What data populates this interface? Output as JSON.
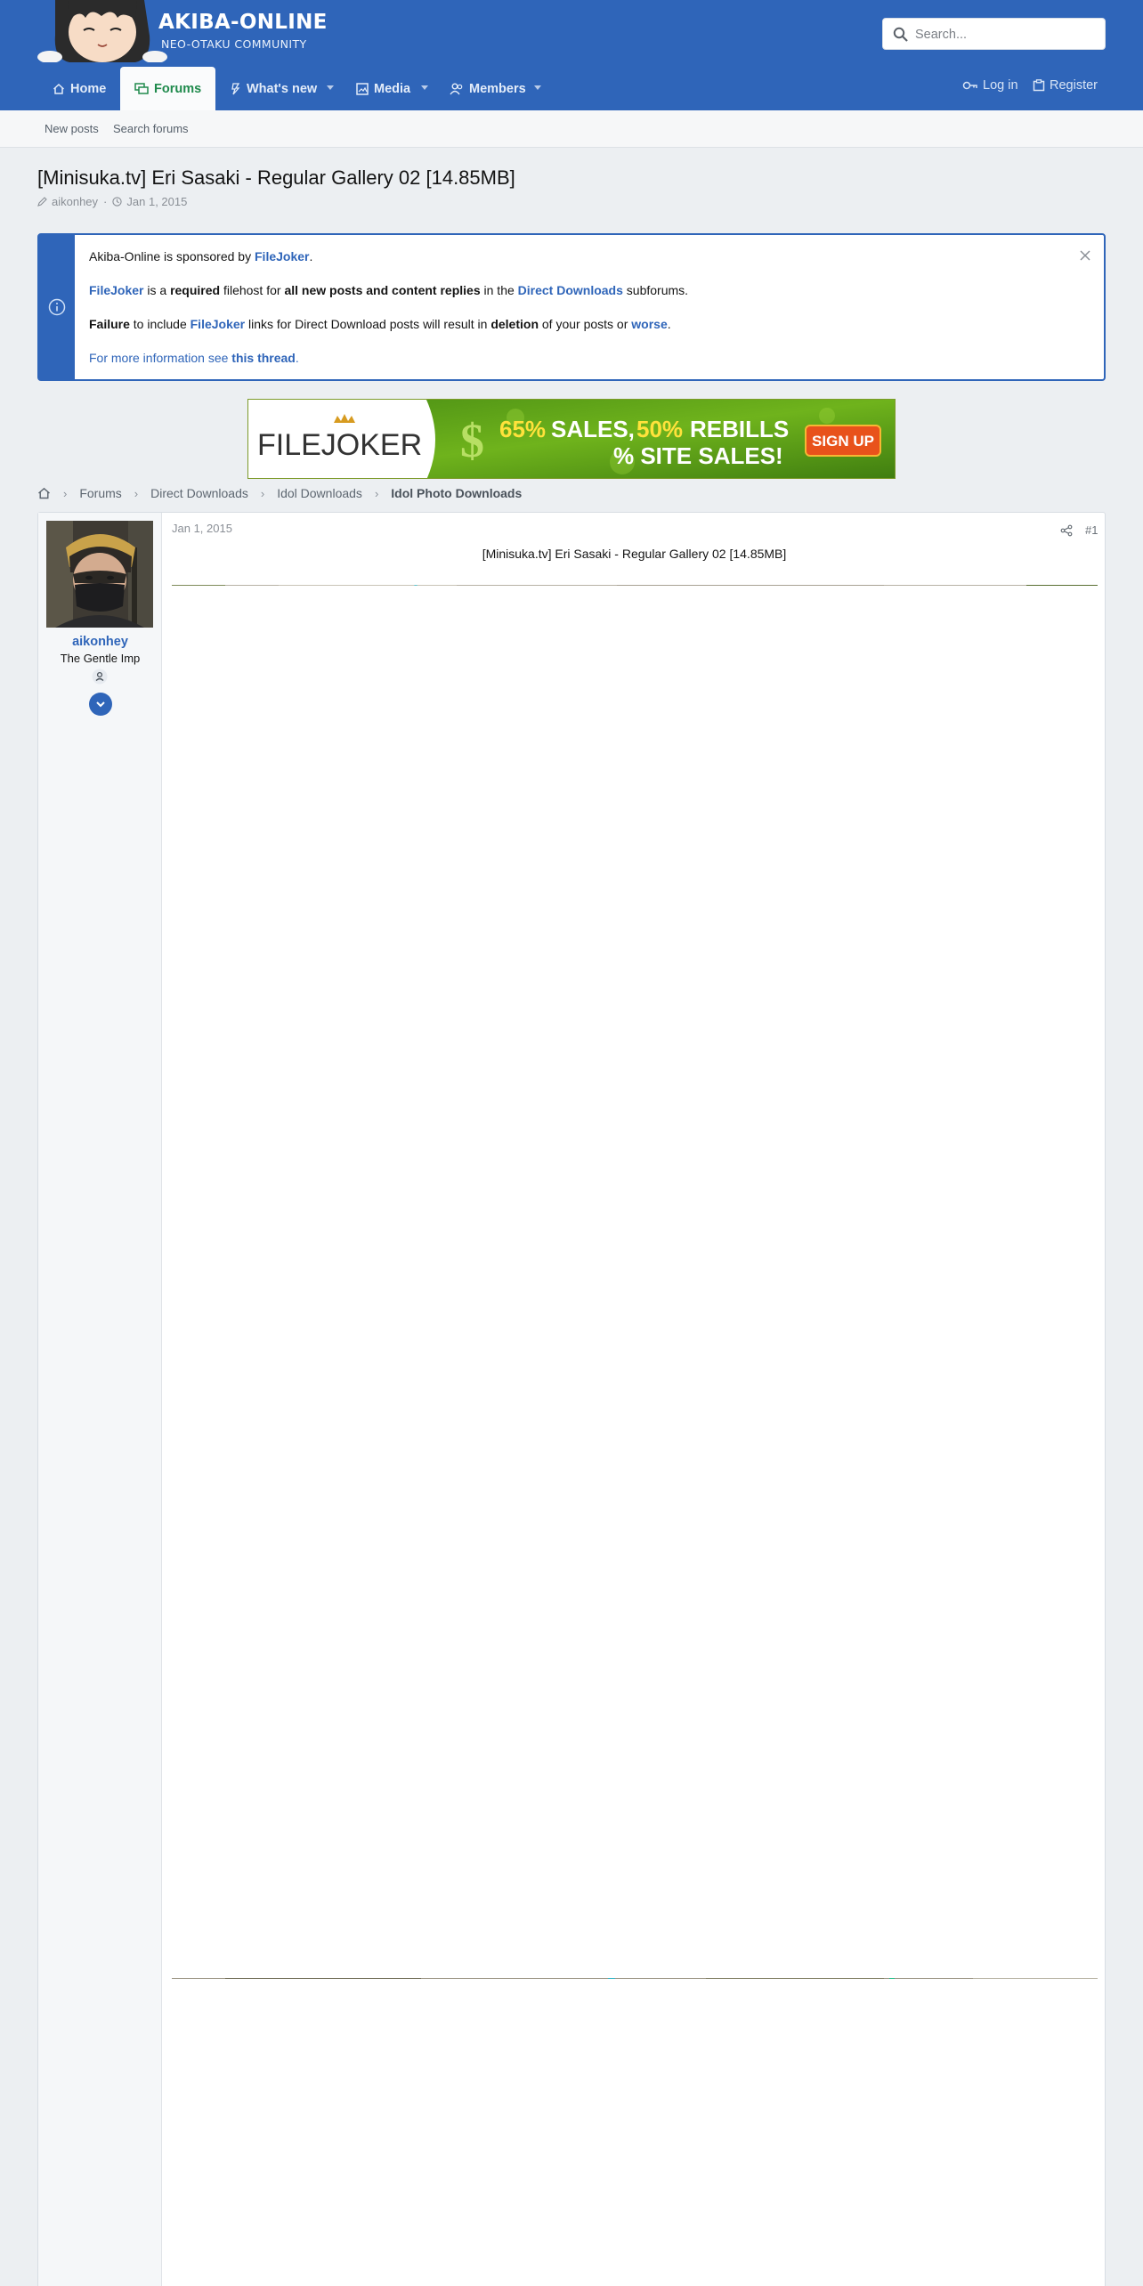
{
  "logo": {
    "title": "AKIBA-ONLINE",
    "subtitle": "NEO-OTAKU COMMUNITY"
  },
  "search": {
    "placeholder": "Search..."
  },
  "nav": {
    "home": "Home",
    "forums": "Forums",
    "whats_new": "What's new",
    "media": "Media",
    "members": "Members",
    "login": "Log in",
    "register": "Register"
  },
  "subnav": {
    "new_posts": "New posts",
    "search_forums": "Search forums"
  },
  "thread": {
    "title": "[Minisuka.tv] Eri Sasaki - Regular Gallery 02 [14.85MB]",
    "author": "aikonhey",
    "date": "Jan 1, 2015"
  },
  "notice": {
    "l1_a": "Akiba-Online is sponsored by ",
    "l1_link": "FileJoker",
    "l1_b": ".",
    "l2_link": "FileJoker",
    "l2_a": " is a ",
    "l2_req": "required",
    "l2_b": " filehost for ",
    "l2_all": "all new posts and content replies",
    "l2_c": " in the ",
    "l2_dd": "Direct Downloads",
    "l2_d": " subforums.",
    "l3_fail": "Failure",
    "l3_a": " to include ",
    "l3_link": "FileJoker",
    "l3_b": " links for Direct Download posts will result in ",
    "l3_del": "deletion",
    "l3_c": " of your posts or ",
    "l3_worse": "worse",
    "l3_d": ".",
    "l4_a": "For more information see ",
    "l4_link": "this thread",
    "l4_b": "."
  },
  "banner": {
    "brand": "FILEJOKER",
    "pct1": "65%",
    "w1": "SALES,",
    "pct2": "50%",
    "w2": "REBILLS",
    "w3": "% SITE SALES!",
    "cta": "SIGN UP"
  },
  "breadcrumb": [
    "Forums",
    "Direct Downloads",
    "Idol Downloads",
    "Idol Photo Downloads"
  ],
  "post": {
    "date": "Jan 1, 2015",
    "number": "#1",
    "username": "aikonhey",
    "user_title": "The Gentle Imp",
    "content_title": "[Minisuka.tv] Eri Sasaki - Regular Gallery 02 [14.85MB]"
  },
  "colors": {
    "brand_blue": "#2f65b9",
    "active_green": "#1f8a4c",
    "page_bg": "#eceff2"
  },
  "icons": [
    "search-icon",
    "home-icon",
    "forums-icon",
    "whats-new-icon",
    "media-icon",
    "members-icon",
    "login-key-icon",
    "register-icon",
    "pen-icon",
    "clock-icon",
    "info-icon",
    "close-icon",
    "share-icon",
    "chevron-down-icon"
  ]
}
